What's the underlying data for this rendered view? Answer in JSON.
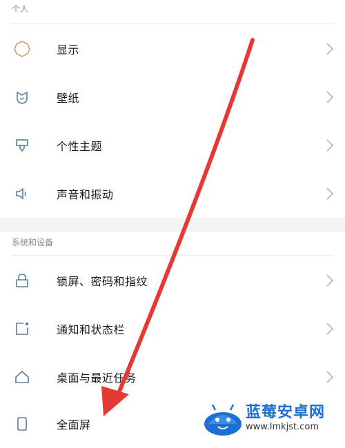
{
  "sections": {
    "personal": {
      "title": "个人"
    },
    "system": {
      "title": "系统和设备"
    }
  },
  "items": [
    {
      "label": "显示",
      "icon": "brightness-icon"
    },
    {
      "label": "壁纸",
      "icon": "wallpaper-icon"
    },
    {
      "label": "个性主题",
      "icon": "theme-brush-icon"
    },
    {
      "label": "声音和振动",
      "icon": "speaker-icon"
    },
    {
      "label": "锁屏、密码和指纹",
      "icon": "lock-icon"
    },
    {
      "label": "通知和状态栏",
      "icon": "notification-icon"
    },
    {
      "label": "桌面与最近任务",
      "icon": "home-icon"
    },
    {
      "label": "全面屏",
      "icon": "phone-screen-icon"
    }
  ],
  "watermark": {
    "title": "蓝莓安卓网",
    "url": "www.lmkjst.com"
  },
  "colors": {
    "icon": "#5a7f95",
    "arrow": "#e53935",
    "chevron": "#b5b5b5",
    "brand": "#1d6fd1"
  }
}
